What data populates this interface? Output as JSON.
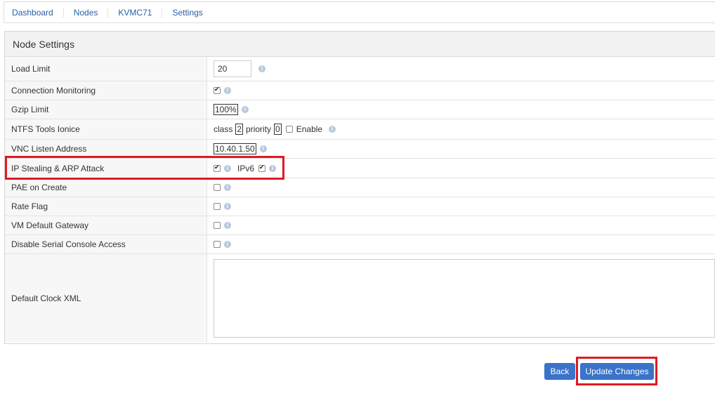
{
  "breadcrumb": [
    "Dashboard",
    "Nodes",
    "KVMC71",
    "Settings"
  ],
  "panel_title": "Node Settings",
  "rows": {
    "load_limit": {
      "label": "Load Limit",
      "value": "20"
    },
    "connection_monitoring": {
      "label": "Connection Monitoring",
      "checked": true
    },
    "gzip_limit": {
      "label": "Gzip Limit",
      "value": "100%"
    },
    "ntfs_tools_ionice": {
      "label": "NTFS Tools Ionice",
      "class_label": "class",
      "class_value": "2",
      "priority_label": "priority",
      "priority_value": "0",
      "enable_label": "Enable",
      "enabled": false
    },
    "vnc_listen_address": {
      "label": "VNC Listen Address",
      "value": "10.40.1.50"
    },
    "ip_stealing": {
      "label": "IP Stealing & ARP Attack",
      "checked": true,
      "ipv6_label": "IPv6",
      "ipv6_checked": true
    },
    "pae_on_create": {
      "label": "PAE on Create",
      "checked": false
    },
    "rate_flag": {
      "label": "Rate Flag",
      "checked": false
    },
    "vm_default_gateway": {
      "label": "VM Default Gateway",
      "checked": false
    },
    "disable_serial_console": {
      "label": "Disable Serial Console Access",
      "checked": false
    },
    "default_clock_xml": {
      "label": "Default Clock XML",
      "value": ""
    }
  },
  "buttons": {
    "back": "Back",
    "update": "Update Changes"
  },
  "colors": {
    "link": "#2a5da8",
    "button": "#3a73c9",
    "highlight": "#e01a22"
  }
}
